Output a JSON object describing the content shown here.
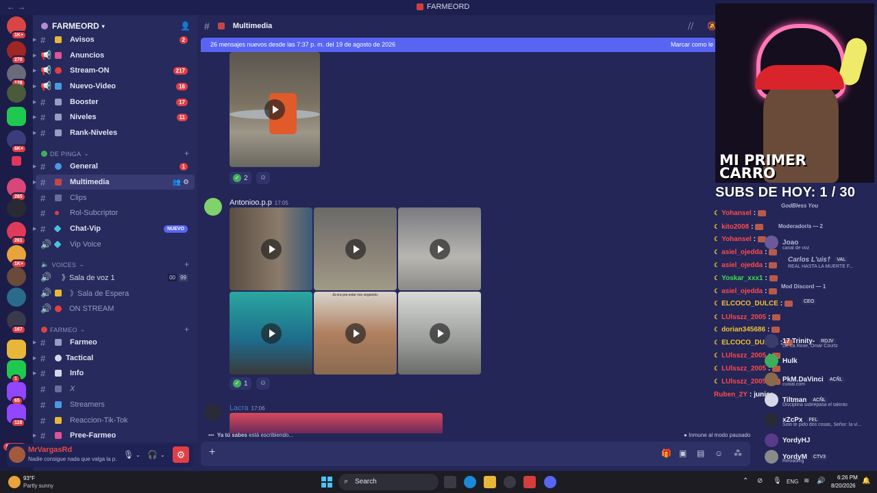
{
  "window": {
    "title": "FARMEORD"
  },
  "rail": {
    "badges": [
      "1K+",
      "270",
      "128",
      "6K+",
      "265",
      "1K+",
      "261",
      "167",
      "1",
      "65",
      "118"
    ],
    "nuevo_label": "NUEVO"
  },
  "guild": {
    "name": "FARMEORD"
  },
  "channels_top": [
    {
      "name": "Avisos",
      "count": "2"
    },
    {
      "name": "Anuncios",
      "count": ""
    },
    {
      "name": "Stream-ON",
      "count": "217"
    },
    {
      "name": "Nuevo-Video",
      "count": "16"
    },
    {
      "name": "Booster",
      "count": "17"
    },
    {
      "name": "Niveles",
      "count": "11"
    },
    {
      "name": "Rank-Niveles",
      "count": ""
    }
  ],
  "category_1": "DE PINGA",
  "channels_mid": [
    {
      "name": "General",
      "count": "1"
    },
    {
      "name": "Multimedia",
      "count": ""
    },
    {
      "name": "Clips",
      "count": ""
    },
    {
      "name": "Rol-Subcriptor",
      "count": ""
    },
    {
      "name": "Chat-Vip",
      "badge": "NUEVO"
    },
    {
      "name": "Vip Voice",
      "count": ""
    }
  ],
  "category_2": "VOICES",
  "voice_channels": [
    {
      "name": "》Sala de voz 1",
      "a": "00",
      "b": "99"
    },
    {
      "name": "》Sala de Espera"
    },
    {
      "name": "ON STREAM"
    }
  ],
  "category_3": "FARMEO",
  "channels_bottom": [
    "Farmeo",
    "Tactical",
    "Info",
    "X",
    "Streamers",
    "Reaccion-Tik-Tok",
    "Pree-Farmeo"
  ],
  "user": {
    "name": "MrVargasRd",
    "status": "Nadie consigue nada que valga la p..."
  },
  "chat": {
    "channel": "Multimedia",
    "new_messages": "26 mensajes nuevos desde las 7:37 p. m. del 19 de agosto de 2026",
    "mark_read": "Marcar como le",
    "msg1_reaction": "2",
    "msg2_author": "Antonioo.p.p",
    "msg2_time": "17:05",
    "msg2_reaction": "1",
    "msg3_author": "Lacra",
    "msg3_time": "17:06",
    "video_caption": "Já era pra estar nos seguindo.",
    "typing_user": "Ya tú sabes",
    "typing_text": " está escribiendo...",
    "paused": "Inmune al modo pausado"
  },
  "stream": {
    "banner": "MI PRIMER CARRO",
    "subs": "SUBS DE HOY: 1 / 30",
    "chat": [
      {
        "user": "Yohansel",
        "color": "#ff4b4b"
      },
      {
        "user": "kito2008",
        "color": "#ff4b4b"
      },
      {
        "user": "Yohansel",
        "color": "#ff4b4b"
      },
      {
        "user": "asiel_ojedda",
        "color": "#ff4b4b"
      },
      {
        "user": "asiel_ojedda",
        "color": "#ff4b4b"
      },
      {
        "user": "Yoskar_xxx1",
        "color": "#3de04b"
      },
      {
        "user": "asiel_ojedda",
        "color": "#ff4b4b"
      },
      {
        "user": "ELCOCO_DULCE",
        "color": "#f3c233"
      },
      {
        "user": "LUlsszz_2005",
        "color": "#ff4b4b"
      },
      {
        "user": "dorian345686",
        "color": "#f3c233"
      },
      {
        "user": "ELCOCO_DULCE",
        "color": "#f3c233"
      },
      {
        "user": "LUlsszz_2005",
        "color": "#ff4b4b"
      },
      {
        "user": "LUlsszz_2005",
        "color": "#ff4b4b"
      },
      {
        "user": "LUlsszz_2005",
        "color": "#ff4b4b"
      },
      {
        "user": "Ruben_2Y",
        "color": "#ff4b4b",
        "msg": "junior"
      }
    ],
    "voice": {
      "joao": "Joao",
      "canal": "canal de voz",
      "carlos": "Carlos L'uis†",
      "carlos_tag": "VAL",
      "carlos_sub": "REAL HASTA LA MUERTE F...",
      "mod": "Mod Discord — 1",
      "moderador": "Moderador/a — 2",
      "godbless": "GodBless You",
      "ceo": "CEO",
      "trinity": "17 Trinity-",
      "trinity_tag": "RDJV",
      "trinity_sub": "De La Rose, Omar Courtz",
      "hulk": "Hulk",
      "pkm": "PkM.DaVinci",
      "pkm_tag": "ACÑL",
      "pkm_sub": "cuxial.com",
      "tiltman": "Tiltman",
      "tiltman_tag": "ACÑL",
      "tiltman_sub": "Disciplina sobrepasa el talento",
      "xzc": "xZcPx",
      "xzc_tag": "FEL",
      "xzc_sub": "Solo te pido dos cosas, Señor: la vi...",
      "yordyhj": "YordyHJ",
      "yordym": "YordyM",
      "yordym_tag": "CTV3",
      "yordym_sub": "Reloading"
    }
  },
  "taskbar": {
    "temp": "93°F",
    "condition": "Partly sunny",
    "search": "Search",
    "lang": "ENG",
    "time": "6:26 PM",
    "date": "8/20/2026"
  }
}
